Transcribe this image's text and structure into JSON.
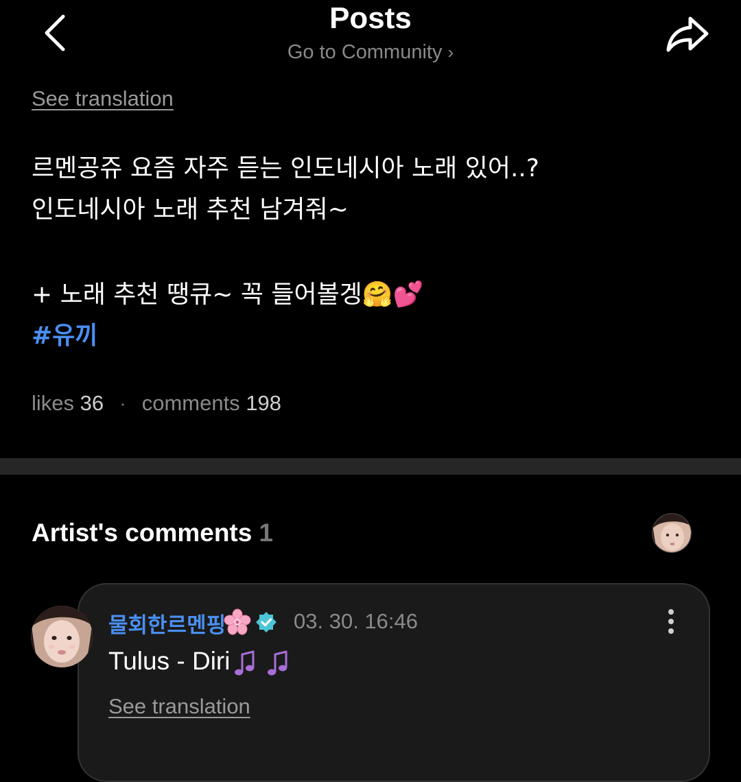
{
  "header": {
    "title": "Posts",
    "subtitle": "Go to Community",
    "subtitle_chevron": "›",
    "back_icon": "chevron-left-icon",
    "share_icon": "share-arrow-icon"
  },
  "post": {
    "see_translation": "See translation",
    "lines": [
      "르멘공쥬 요즘 자주 듣는 인도네시아 노래 있어..?",
      "인도네시아 노래 추천 남겨줘~",
      "+ 노래 추천 땡큐~ 꼭 들어볼겡🤗💕"
    ],
    "hashtag": "#유끼",
    "likes_label": "likes",
    "likes": "36",
    "dot": "·",
    "comments_label": "comments",
    "comments": "198"
  },
  "artist_comments": {
    "title": "Artist's comments",
    "count": "1"
  },
  "comment": {
    "author": "물회한르멘핑",
    "timestamp": "03. 30. 16:46",
    "text": "Tulus - Diri",
    "see_translation": "See translation"
  },
  "colors": {
    "background": "#000000",
    "accent": "#4a8ff0",
    "muted": "#8a8a8a",
    "card": "#1a1a1a",
    "verified": "#4cc6d6"
  }
}
